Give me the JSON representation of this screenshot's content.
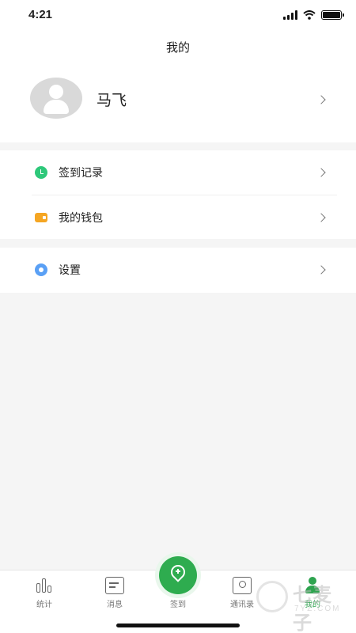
{
  "status_bar": {
    "time": "4:21"
  },
  "nav": {
    "title": "我的"
  },
  "profile": {
    "name": "马飞"
  },
  "menu": {
    "group1": [
      {
        "label": "签到记录",
        "icon": "clock-check-icon",
        "icon_color": "#2ec87a"
      },
      {
        "label": "我的钱包",
        "icon": "wallet-icon",
        "icon_color": "#f5a623"
      }
    ],
    "group2": [
      {
        "label": "设置",
        "icon": "gear-icon",
        "icon_color": "#5aa0f5"
      }
    ]
  },
  "tabs": [
    {
      "label": "统计",
      "icon": "bar-chart-icon"
    },
    {
      "label": "消息",
      "icon": "message-icon"
    },
    {
      "label": "签到",
      "icon": "location-pin-icon",
      "color": "#2eac4f"
    },
    {
      "label": "通讯录",
      "icon": "contacts-icon"
    },
    {
      "label": "我的",
      "icon": "person-icon",
      "active": true,
      "color": "#2ea44f"
    }
  ],
  "watermark": {
    "text": "七麦子",
    "sub": "7YZ.COM"
  }
}
